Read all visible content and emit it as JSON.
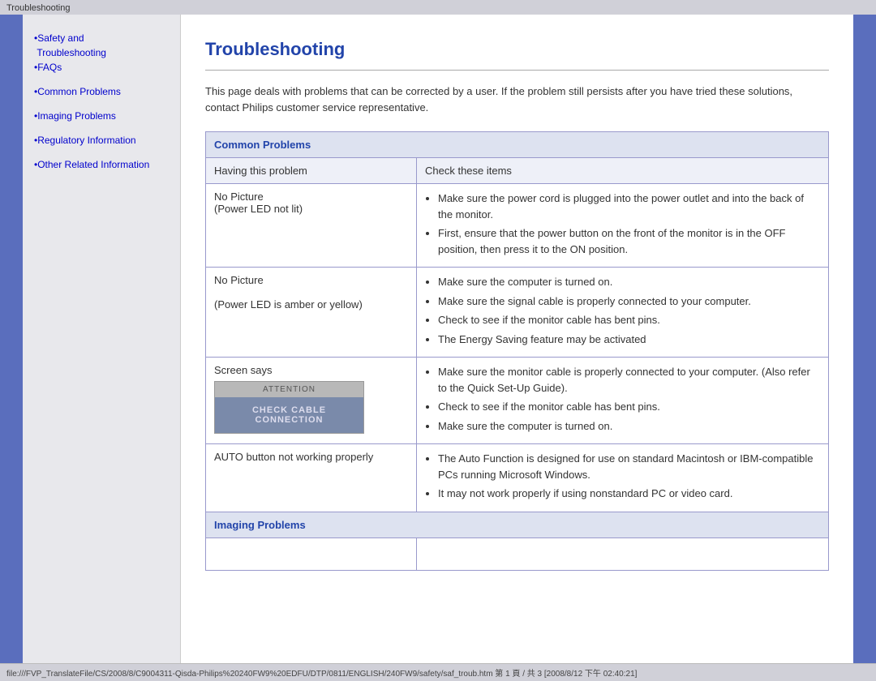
{
  "browser": {
    "tab_title": "Troubleshooting",
    "status_bar": "file:///FVP_TranslateFile/CS/2008/8/C9004311-Qisda-Philips%20240FW9%20EDFU/DTP/0811/ENGLISH/240FW9/safety/saf_troub.htm 第 1 頁 / 共 3 [2008/8/12 下午 02:40:21]"
  },
  "sidebar": {
    "items": [
      {
        "label": "•Safety and Troubleshooting",
        "href": "#"
      },
      {
        "label": "•FAQs",
        "href": "#"
      },
      {
        "label": "•Common Problems",
        "href": "#"
      },
      {
        "label": "•Imaging Problems",
        "href": "#"
      },
      {
        "label": "•Regulatory Information",
        "href": "#"
      },
      {
        "label": "•Other Related Information",
        "href": "#"
      }
    ]
  },
  "page": {
    "title": "Troubleshooting",
    "intro": "This page deals with problems that can be corrected by a user. If the problem still persists after you have tried these solutions, contact Philips customer service representative."
  },
  "table": {
    "common_problems_header": "Common Problems",
    "imaging_problems_header": "Imaging Problems",
    "col_problem": "Having this problem",
    "col_solution": "Check these items",
    "rows": [
      {
        "problem": "No Picture\n(Power LED not lit)",
        "solutions": [
          "Make sure the power cord is plugged into the power outlet and into the back of the monitor.",
          "First, ensure that the power button on the front of the monitor is in the OFF position, then press it to the ON position."
        ]
      },
      {
        "problem": "No Picture\n\n(Power LED is amber or yellow)",
        "solutions": [
          "Make sure the computer is turned on.",
          "Make sure the signal cable is properly connected to your computer.",
          "Check to see if the monitor cable has bent pins.",
          "The Energy Saving feature may be activated"
        ]
      },
      {
        "problem_type": "screen_says",
        "problem_label": "Screen says",
        "attention_label": "ATTENTION",
        "check_cable_label": "CHECK CABLE CONNECTION",
        "solutions": [
          "Make sure the monitor cable is properly connected to your computer. (Also refer to the Quick Set-Up Guide).",
          "Check to see if the monitor cable has bent pins.",
          "Make sure the computer is turned on."
        ]
      },
      {
        "problem": "AUTO button not working properly",
        "solutions": [
          "The Auto Function is designed for use on standard Macintosh or IBM-compatible PCs running Microsoft Windows.",
          "It may not work properly if using nonstandard PC or video card."
        ]
      }
    ]
  }
}
